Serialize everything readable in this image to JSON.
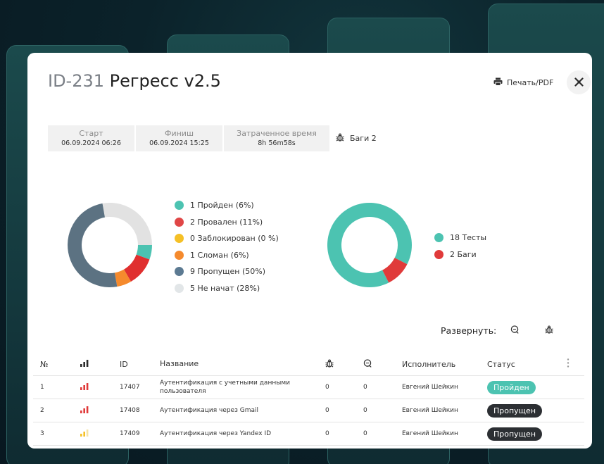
{
  "header": {
    "id": "ID-231",
    "title": "Регресс v2.5",
    "print_label": "Печать/PDF"
  },
  "stats": [
    {
      "label": "Старт",
      "value": "06.09.2024 06:26"
    },
    {
      "label": "Финиш",
      "value": "06.09.2024 15:25"
    },
    {
      "label": "Затраченное время",
      "value": "8h 56m58s"
    }
  ],
  "bugs_stat": "Баги 2",
  "chart_data": [
    {
      "type": "pie",
      "categories": [
        "Пройден",
        "Провален",
        "Заблокирован",
        "Сломан",
        "Пропущен",
        "Не начат"
      ],
      "values": [
        1,
        2,
        0,
        1,
        9,
        5
      ],
      "colors": [
        "#4cc3b1",
        "#e04646",
        "#f5c026",
        "#f58a2d",
        "#5c7282",
        "#e2e2e2"
      ],
      "legend": [
        "1 Пройден (6%)",
        "2 Провален (11%)",
        "0 Заблокирован (0 %)",
        "1 Сломан (6%)",
        "9 Пропущен (50%)",
        "5 Не начат (28%)"
      ],
      "legend_colors": [
        "#4cc3b1",
        "#e04646",
        "#f5c026",
        "#f58a2d",
        "#5c7a92",
        "#e2e6e8"
      ],
      "drawn_colors": [
        "#4cc3b1",
        "#e02f2f",
        "#fbc667",
        "#f58a2d",
        "#5c7282",
        "#e2e2e2"
      ]
    },
    {
      "type": "pie",
      "categories": [
        "Тесты",
        "Баги"
      ],
      "values": [
        18,
        2
      ],
      "colors": [
        "#4cc3b1",
        "#e03a3a"
      ],
      "legend": [
        "18 Тесты",
        "2 Баги"
      ]
    }
  ],
  "expand_label": "Развернуть:",
  "table": {
    "headers": {
      "num": "№",
      "id": "ID",
      "name": "Название",
      "executor": "Исполнитель",
      "status": "Статус"
    },
    "rows": [
      {
        "num": "1",
        "id": "17407",
        "name": "Аутентификация с учетными данными пользователя",
        "bugs": "0",
        "comments": "0",
        "executor": "Евгений Шейкин",
        "status": "Пройден",
        "status_kind": "passed",
        "priority_color": "#e03a3a"
      },
      {
        "num": "2",
        "id": "17408",
        "name": "Аутентификация через Gmail",
        "bugs": "0",
        "comments": "0",
        "executor": "Евгений Шейкин",
        "status": "Пропущен",
        "status_kind": "skipped",
        "priority_color": "#e03a3a"
      },
      {
        "num": "3",
        "id": "17409",
        "name": "Аутентификация через Yandex ID",
        "bugs": "0",
        "comments": "0",
        "executor": "Евгений Шейкин",
        "status": "Пропущен",
        "status_kind": "skipped",
        "priority_color": "#f5c026"
      }
    ]
  },
  "icons": {
    "print": "printer-icon",
    "close": "close-icon",
    "bug": "bug-icon",
    "comment": "comment-icon",
    "priority": "priority-bars-icon",
    "more": "more-vertical-icon"
  }
}
